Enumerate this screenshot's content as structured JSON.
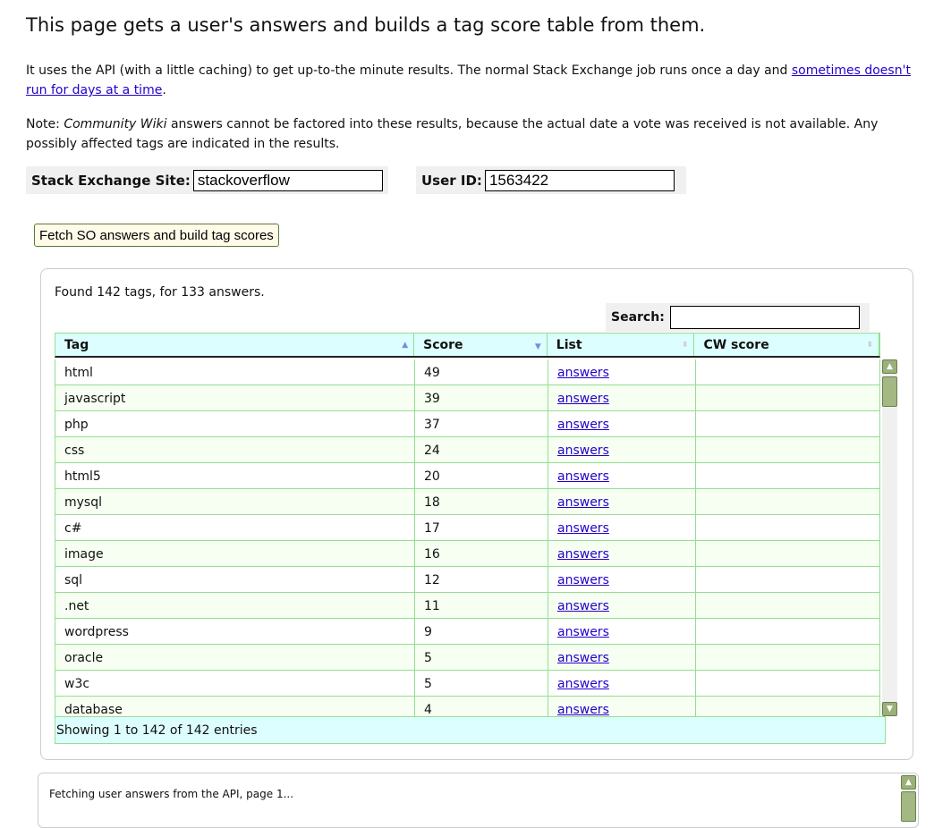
{
  "title": "This page gets a user's answers and builds a tag score table from them.",
  "intro": {
    "text": "It uses the API (with a little caching) to get up-to-the minute results. The normal Stack Exchange job runs once a day and ",
    "link": "sometimes doesn't run for days at a time",
    "end": "."
  },
  "note": {
    "prefix": "Note: ",
    "em": "Community Wiki",
    "text": " answers cannot be factored into these results, because the actual date a vote was received is not available. Any possibly affected tags are indicated in the results."
  },
  "form": {
    "site_label": "Stack Exchange Site:",
    "site_value": "stackoverflow",
    "user_label": "User ID:",
    "user_value": "1563422",
    "fetch_button": "Fetch SO answers and build tag scores"
  },
  "results": {
    "found": "Found 142 tags, for 133 answers.",
    "search_label": "Search:",
    "search_value": "",
    "columns": [
      "Tag",
      "Score",
      "List",
      "CW score"
    ],
    "sort": {
      "column": "Score",
      "direction": "descending"
    },
    "rows": [
      {
        "tag": "html",
        "score": "49",
        "list": "answers",
        "cw": ""
      },
      {
        "tag": "javascript",
        "score": "39",
        "list": "answers",
        "cw": ""
      },
      {
        "tag": "php",
        "score": "37",
        "list": "answers",
        "cw": ""
      },
      {
        "tag": "css",
        "score": "24",
        "list": "answers",
        "cw": ""
      },
      {
        "tag": "html5",
        "score": "20",
        "list": "answers",
        "cw": ""
      },
      {
        "tag": "mysql",
        "score": "18",
        "list": "answers",
        "cw": ""
      },
      {
        "tag": "c#",
        "score": "17",
        "list": "answers",
        "cw": ""
      },
      {
        "tag": "image",
        "score": "16",
        "list": "answers",
        "cw": ""
      },
      {
        "tag": "sql",
        "score": "12",
        "list": "answers",
        "cw": ""
      },
      {
        "tag": ".net",
        "score": "11",
        "list": "answers",
        "cw": ""
      },
      {
        "tag": "wordpress",
        "score": "9",
        "list": "answers",
        "cw": ""
      },
      {
        "tag": "oracle",
        "score": "5",
        "list": "answers",
        "cw": ""
      },
      {
        "tag": "w3c",
        "score": "5",
        "list": "answers",
        "cw": ""
      },
      {
        "tag": "database",
        "score": "4",
        "list": "answers",
        "cw": ""
      }
    ],
    "footer": "Showing 1 to 142 of 142 entries"
  },
  "log": {
    "line": "Fetching user answers from the API, page 1..."
  }
}
